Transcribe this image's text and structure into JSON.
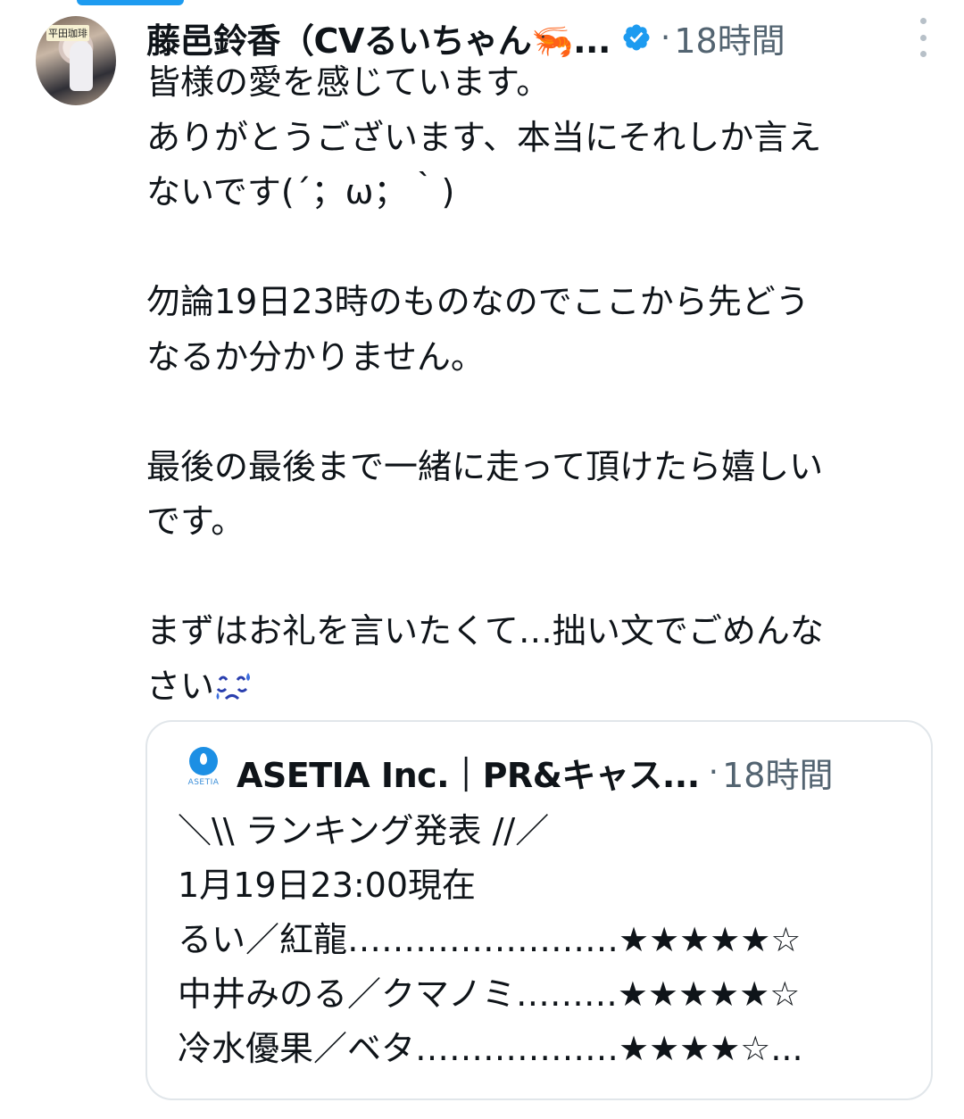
{
  "tweet": {
    "author_name": "藤邑鈴香（CVるいちゃん🦐...",
    "separator": "·",
    "time": "18時間",
    "avatar_sign": "平田珈琲",
    "lines": [
      "皆様の愛を感じています。",
      "ありがとうございます、本当にそれしか言え",
      "ないです(´；ω；｀)",
      "",
      "勿論19日23時のものなのでここから先どう",
      "なるか分かりません。",
      "",
      "最後の最後まで一緒に走って頂けたら嬉しい",
      "です。",
      "",
      "まずはお礼を言いたくて…拙い文でごめんな",
      "さい"
    ]
  },
  "quote": {
    "logo_text": "ASETIA",
    "author_name": "ASETIA Inc.｜PR&キャス...",
    "separator": "·",
    "time": "18時間",
    "lines": [
      "＼\\\\ ランキング発表 //／",
      "1月19日23:00現在",
      "るい／紅龍……………………★★★★★☆",
      "中井みのる／クマノミ………★★★★★☆",
      "冷水優果／ベタ………………★★★★☆..."
    ]
  },
  "icons": {
    "verified": "verified-badge-icon",
    "more": "more-options-icon",
    "emoji": "sweat-face-emoji-icon"
  },
  "colors": {
    "accent": "#1d9bf0",
    "secondary_text": "#536471",
    "border": "#e1e6ea"
  }
}
